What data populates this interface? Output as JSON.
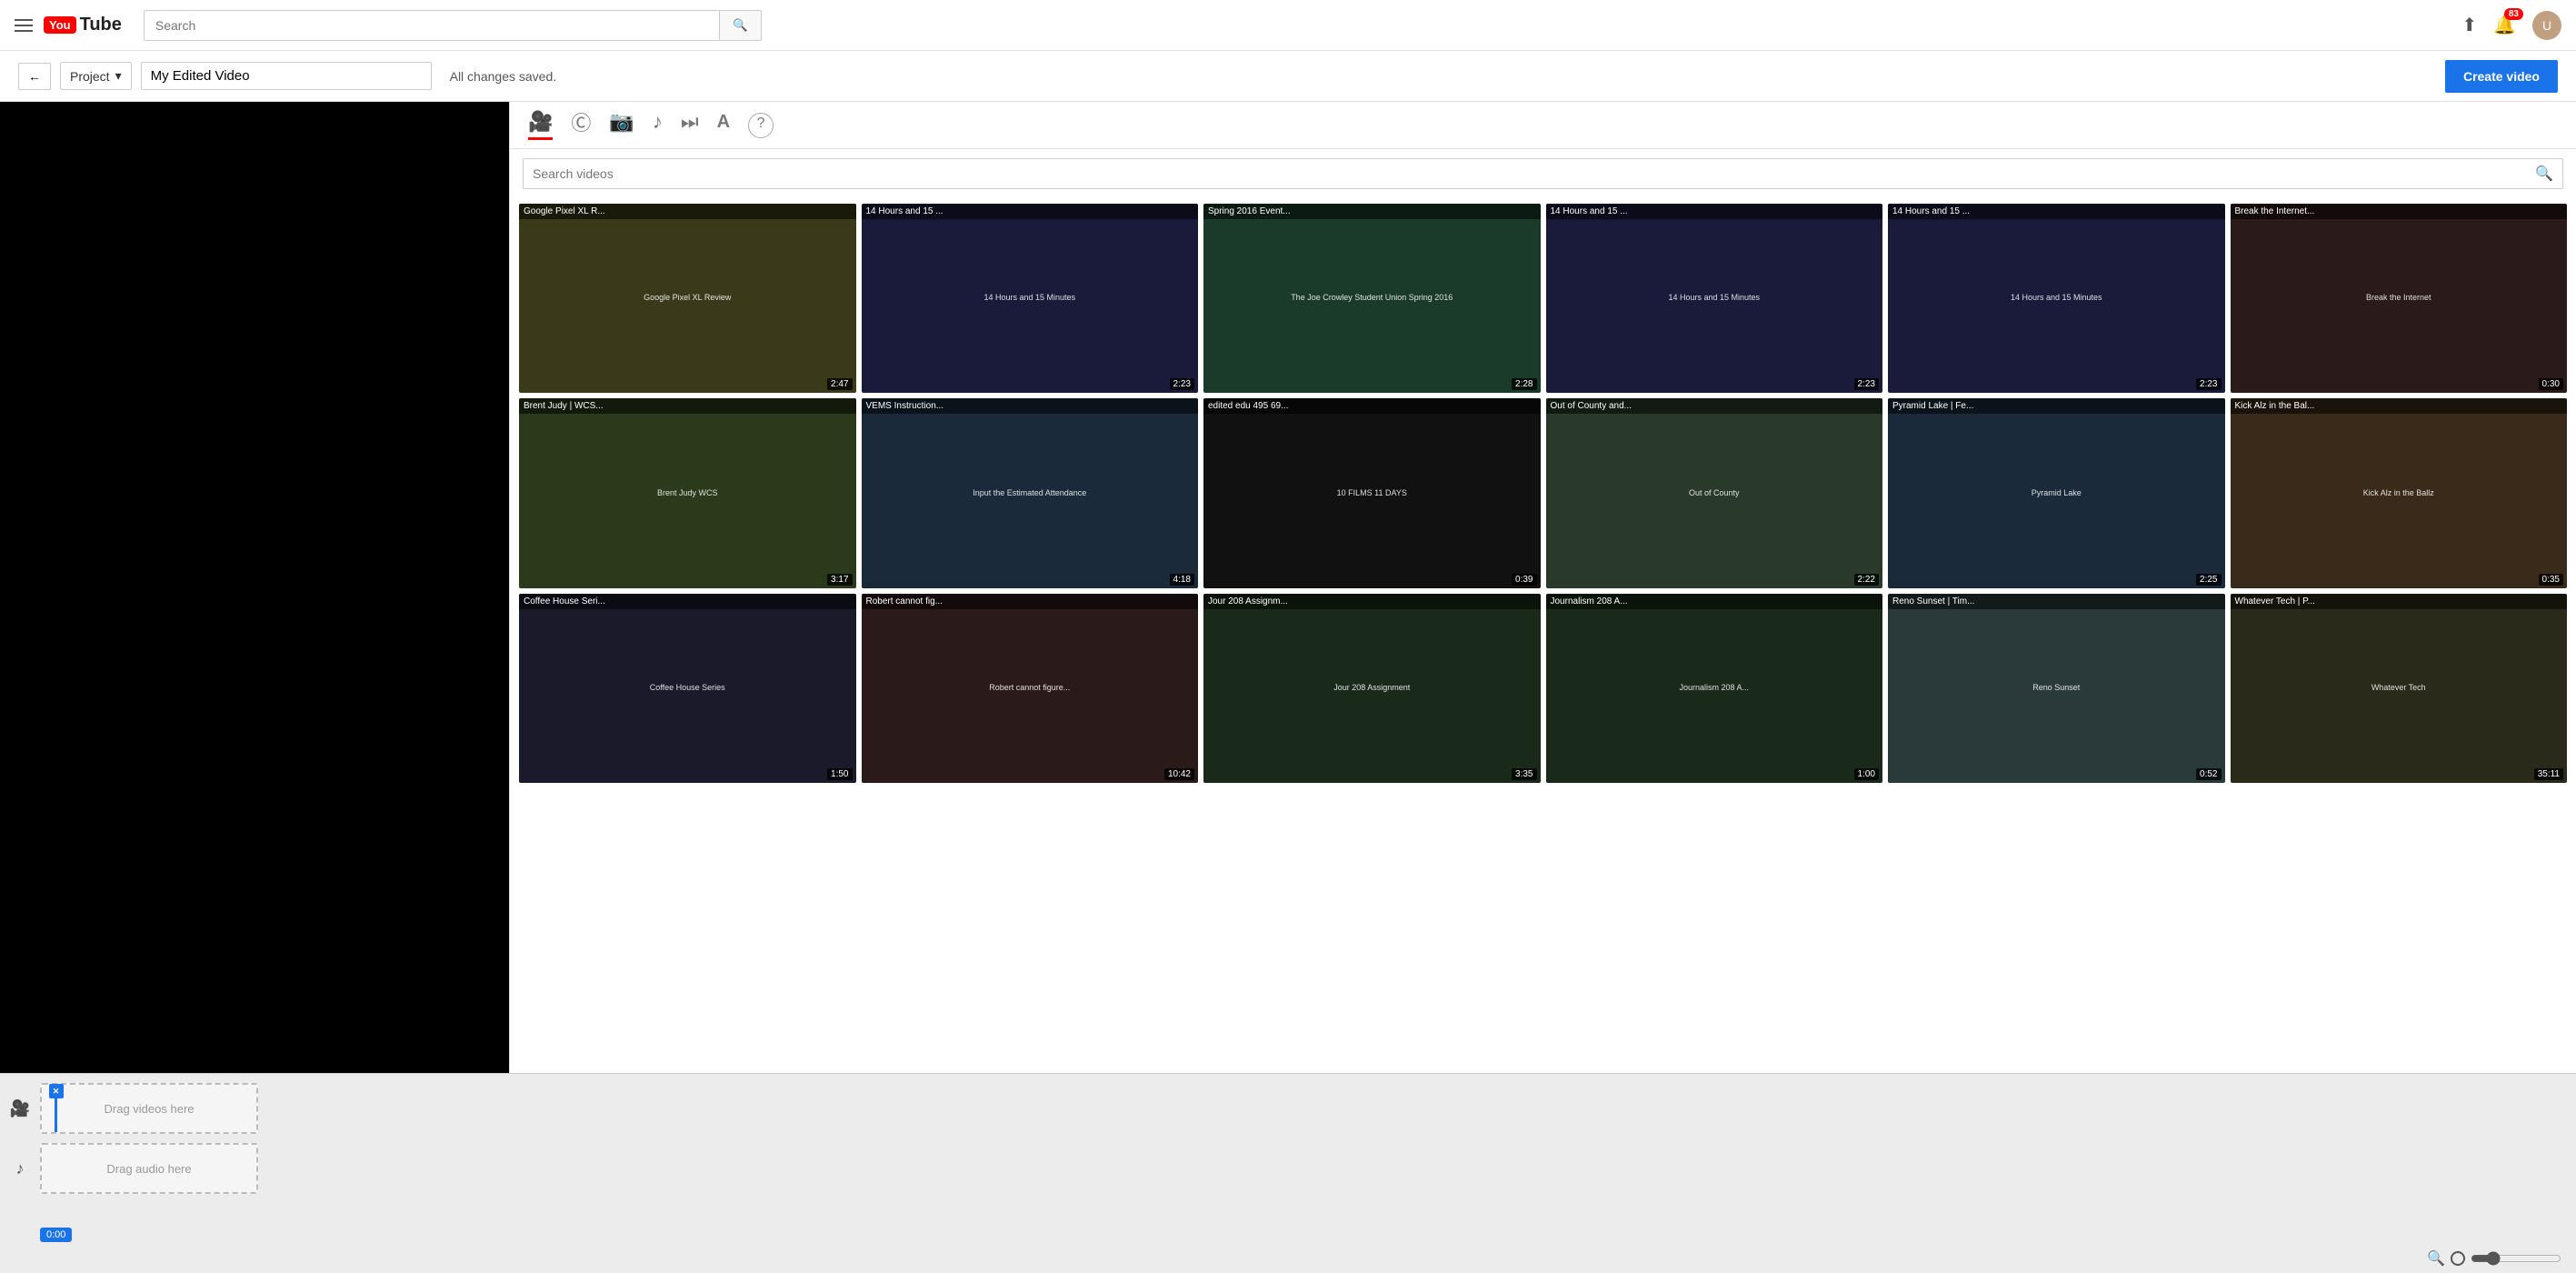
{
  "nav": {
    "search_placeholder": "Search",
    "notification_count": "83",
    "avatar_initials": "U"
  },
  "toolbar": {
    "back_label": "←",
    "project_label": "Project",
    "project_name": "My Edited Video",
    "saved_status": "All changes saved.",
    "create_video_label": "Create video"
  },
  "media_panel": {
    "search_placeholder": "Search videos",
    "tabs": [
      {
        "id": "video",
        "icon": "🎥",
        "active": true
      },
      {
        "id": "captions",
        "icon": "©"
      },
      {
        "id": "photo",
        "icon": "📷"
      },
      {
        "id": "music",
        "icon": "♪"
      },
      {
        "id": "transitions",
        "icon": "⏭"
      },
      {
        "id": "text",
        "icon": "A"
      },
      {
        "id": "help",
        "icon": "?"
      }
    ],
    "videos": [
      {
        "title": "Google Pixel XL R...",
        "duration": "2:47",
        "color": "#3a3a1a",
        "label": "Google Pixel\nXL Review"
      },
      {
        "title": "14 Hours and 15 ...",
        "duration": "2:23",
        "color": "#1a1a3a",
        "label": "14 Hours and 15 Minutes"
      },
      {
        "title": "Spring 2016 Event...",
        "duration": "2:28",
        "color": "#1a3a2a",
        "label": "The Joe Crowley Student Union Spring 2016"
      },
      {
        "title": "14 Hours and 15 ...",
        "duration": "2:23",
        "color": "#1a1a3a",
        "label": "14 Hours and 15 Minutes"
      },
      {
        "title": "14 Hours and 15 ...",
        "duration": "2:23",
        "color": "#1a1a3a",
        "label": "14 Hours and 15 Minutes"
      },
      {
        "title": "Break the Internet...",
        "duration": "0:30",
        "color": "#2a1a1a",
        "label": "Break the Internet"
      },
      {
        "title": "Brent Judy | WCS...",
        "duration": "3:17",
        "color": "#2a3a1a",
        "label": "Brent Judy WCS"
      },
      {
        "title": "VEMS Instruction...",
        "duration": "4:18",
        "color": "#1a2a3a",
        "label": "Input the\nEstimated\nAttendance"
      },
      {
        "title": "edited edu 495 69...",
        "duration": "0:39",
        "color": "#111",
        "label": "10 FILMS\n11 DAYS"
      },
      {
        "title": "Out of County and...",
        "duration": "2:22",
        "color": "#2a3a2a",
        "label": "Out of County"
      },
      {
        "title": "Pyramid Lake | Fe...",
        "duration": "2:25",
        "color": "#1a2a3a",
        "label": "Pyramid Lake"
      },
      {
        "title": "Kick Alz in the Bal...",
        "duration": "0:35",
        "color": "#3a2a1a",
        "label": "Kick Alz in the Ballz"
      },
      {
        "title": "Coffee House Seri...",
        "duration": "1:50",
        "color": "#1a1a2a",
        "label": "Coffee House Series"
      },
      {
        "title": "Robert cannot fig...",
        "duration": "10:42",
        "color": "#2a1a1a",
        "label": "Robert cannot figure..."
      },
      {
        "title": "Jour 208 Assignm...",
        "duration": "3:35",
        "color": "#1a2a1a",
        "label": "Jour 208 Assignment"
      },
      {
        "title": "Journalism 208 A...",
        "duration": "1:00",
        "color": "#1a2a1a",
        "label": "Journalism 208 A..."
      },
      {
        "title": "Reno Sunset | Tim...",
        "duration": "0:52",
        "color": "#2a3a3a",
        "label": "Reno Sunset"
      },
      {
        "title": "Whatever Tech | P...",
        "duration": "35:11",
        "color": "#2a2a1a",
        "label": "Whatever Tech"
      }
    ]
  },
  "timeline": {
    "video_track_label": "Drag videos here",
    "audio_track_label": "Drag audio here",
    "time_label": "0:00",
    "video_icon": "🎥",
    "audio_icon": "♪"
  }
}
